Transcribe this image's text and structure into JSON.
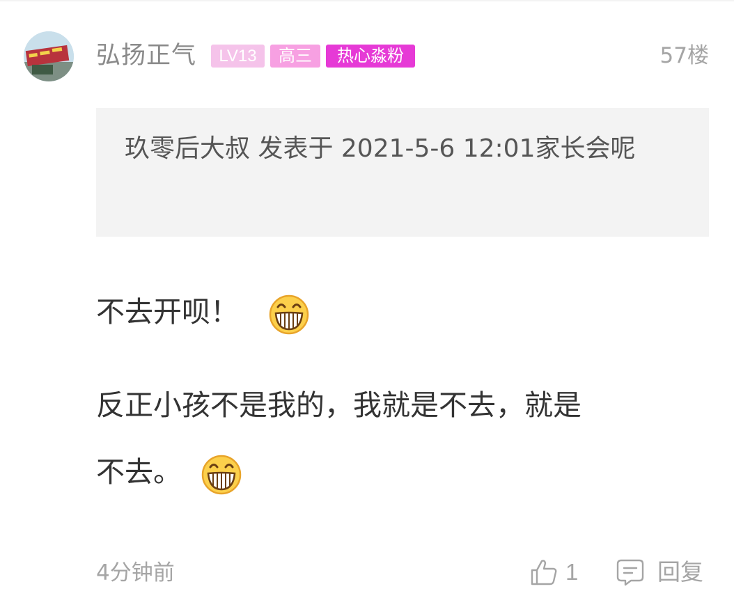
{
  "comment": {
    "username": "弘扬正气",
    "badges": {
      "level": "LV13",
      "grade": "高三",
      "fan": "热心淼粉"
    },
    "floor": "57楼",
    "quote": {
      "text": "玖零后大叔 发表于 2021-5-6 12:01家长会呢"
    },
    "body": {
      "line1": "不去开呗！",
      "line2": "反正小孩不是我的，我就是不去，就是",
      "line3": "不去。"
    },
    "time": "4分钟前",
    "actions": {
      "like_count": "1",
      "reply_label": "回复"
    }
  },
  "icons": {
    "avatar": "avatar-image",
    "emoji": "grin-emoji",
    "like": "thumbs-up-icon",
    "reply": "comment-bubble-icon"
  },
  "colors": {
    "level_badge": "#f5c3ea",
    "grade_badge": "#f7a0e2",
    "fan_badge": "#e63ad6",
    "muted_text": "#a5a5a5",
    "quote_bg": "#f3f3f3"
  }
}
